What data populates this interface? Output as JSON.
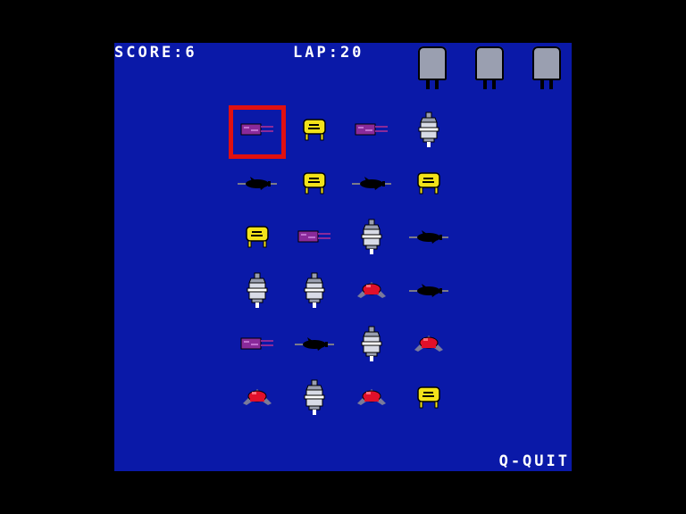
{
  "hud": {
    "score_text": "SCORE:6",
    "lap_text": "LAP:20",
    "quit_text": "Q-QUIT"
  },
  "slots": [
    "empty",
    "empty",
    "empty"
  ],
  "selected": {
    "row": 0,
    "col": 0
  },
  "grid": [
    [
      "purple-bike-icon",
      "yellow-car-icon",
      "purple-bike-icon",
      "spacecraft-icon"
    ],
    [
      "black-plane-icon",
      "yellow-car-icon",
      "black-plane-icon",
      "yellow-car-icon"
    ],
    [
      "yellow-car-icon",
      "purple-bike-icon",
      "spacecraft-icon",
      "black-plane-icon"
    ],
    [
      "spacecraft-icon",
      "spacecraft-icon",
      "red-hat-icon",
      "black-plane-icon"
    ],
    [
      "purple-bike-icon",
      "black-plane-icon",
      "spacecraft-icon",
      "red-hat-icon"
    ],
    [
      "red-hat-icon",
      "spacecraft-icon",
      "red-hat-icon",
      "yellow-car-icon"
    ]
  ],
  "colors": {
    "background": "#0a19a8",
    "border": "#000000",
    "cursor": "#e01010",
    "yellow": "#f2e21a",
    "purple": "#8a2a9a",
    "red": "#e0102a",
    "grey": "#9a9fb0"
  }
}
